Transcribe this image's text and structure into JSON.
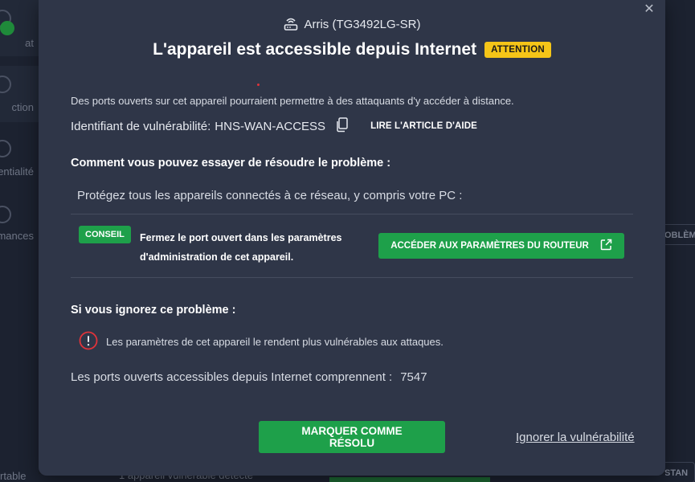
{
  "background": {
    "nav": [
      {
        "label": "at"
      },
      {
        "label": "ction"
      },
      {
        "label": "entialité"
      },
      {
        "label": "mances"
      }
    ],
    "bottom_left": "rtable",
    "bottom_text": "1 appareil vulnérable détecté",
    "right_button_1": "OBLÈM",
    "right_button_2": "STAN"
  },
  "modal": {
    "close_symbol": "✕",
    "device_name": "Arris (TG3492LG-SR)",
    "title": "L'appareil est accessible depuis Internet",
    "badge": "ATTENTION",
    "description": "Des ports ouverts sur cet appareil pourraient permettre à des attaquants d'y accéder à distance.",
    "vulnerability_label": "Identifiant de vulnérabilité:",
    "vulnerability_id": "HNS-WAN-ACCESS",
    "help_link": "LIRE L'ARTICLE D'AIDE",
    "how_to_title": "Comment vous pouvez essayer de résoudre le problème :",
    "protect_text": "Protégez tous les appareils connectés à ce réseau, y compris votre PC :",
    "tip_badge": "CONSEIL",
    "tip_text": "Fermez le port ouvert dans les paramètres d'administration de cet appareil.",
    "router_button": "ACCÉDER AUX PARAMÈTRES DU ROUTEUR",
    "ignore_title": "Si vous ignorez ce problème :",
    "warning_text": "Les paramètres de cet appareil le rendent plus vulnérables aux attaques.",
    "ports_label": "Les ports ouverts accessibles depuis Internet comprennent :",
    "ports_value": "7547",
    "resolve_button": "MARQUER COMME RÉSOLU",
    "ignore_link": "Ignorer la vulnérabilité"
  },
  "colors": {
    "accent_green": "#1ea04a",
    "warning_yellow": "#f5c518",
    "warning_red": "#e0333a",
    "modal_bg": "#2f3648"
  },
  "icons": [
    "router-icon",
    "copy-icon",
    "external-link-icon",
    "exclamation-circle-icon",
    "close-icon"
  ]
}
